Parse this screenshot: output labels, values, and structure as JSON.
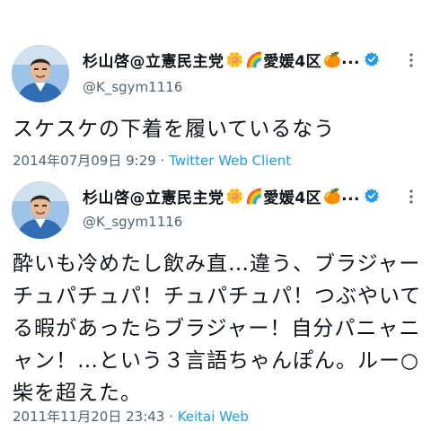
{
  "tweets": [
    {
      "display_name": "杉山啓@立憲民主党",
      "emojis": [
        "🌼",
        "🌈",
        "🍊"
      ],
      "region": "愛媛4区",
      "ellipsis": "...",
      "handle": "@K_sgym1116",
      "text": "スケスケの下着を履いているなう",
      "timestamp": "2014年07月09日 9:29",
      "separator": "·",
      "client": "Twitter Web Client",
      "verified": true
    },
    {
      "display_name": "杉山啓@立憲民主党",
      "emojis": [
        "🌼",
        "🌈",
        "🍊"
      ],
      "region": "愛媛4区",
      "ellipsis": "...",
      "handle": "@K_sgym1116",
      "text": "酔いも冷めたし飲み直…違う、ブラジャーチュパチュパ！チュパチュパ！つぶやいてる暇があったらブラジャー！自分パニャニャン！…という３言語ちゃんぽん。ルー○柴を超えた。",
      "timestamp": "2011年11月20日 23:43",
      "separator": "·",
      "client": "Keitai Web",
      "verified": true
    }
  ],
  "colors": {
    "verified_badge": "#1d9bf0",
    "link": "#1d9bf0",
    "secondary_text": "#536471",
    "primary_text": "#0f1419"
  },
  "icons": {
    "verified": "verified-badge-icon",
    "more": "more-options-icon"
  }
}
